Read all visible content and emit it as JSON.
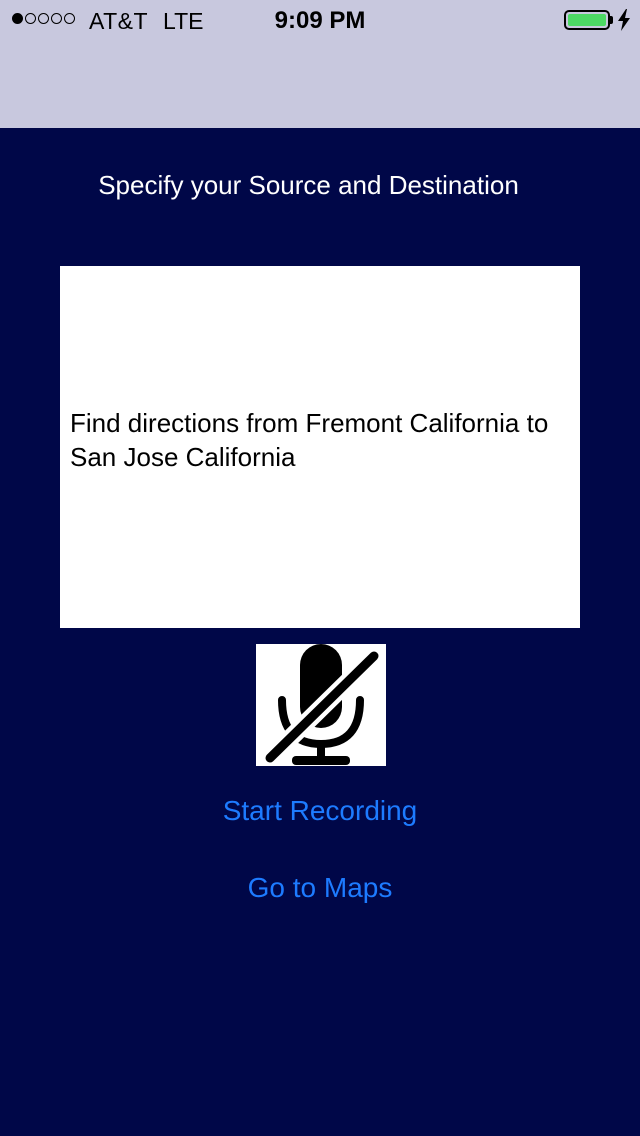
{
  "status_bar": {
    "signal_strength_dots": 1,
    "signal_total_dots": 5,
    "carrier": "AT&T",
    "network": "LTE",
    "time": "9:09 PM",
    "battery_level": 1.0,
    "charging": true,
    "battery_color": "#4cd964"
  },
  "main": {
    "heading": "Specify your Source and Destination",
    "query_text": "Find directions from Fremont California to San Jose California",
    "mic_icon": "microphone-slash-icon",
    "start_recording_label": "Start Recording",
    "go_to_maps_label": "Go to Maps"
  },
  "colors": {
    "background": "#000748",
    "status_region": "#c8c8de",
    "link": "#1d7bff"
  }
}
